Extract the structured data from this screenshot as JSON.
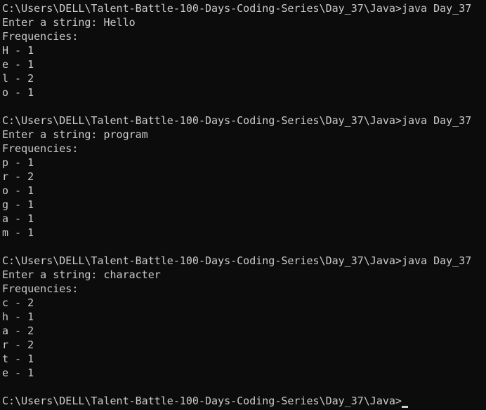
{
  "terminal": {
    "background_color": "#0c0c0c",
    "text_color": "#cccccc",
    "lines": [
      "C:\\Users\\DELL\\Talent-Battle-100-Days-Coding-Series\\Day_37\\Java>java Day_37",
      "Enter a string: Hello",
      "Frequencies:",
      "H - 1",
      "e - 1",
      "l - 2",
      "o - 1",
      "",
      "C:\\Users\\DELL\\Talent-Battle-100-Days-Coding-Series\\Day_37\\Java>java Day_37",
      "Enter a string: program",
      "Frequencies:",
      "p - 1",
      "r - 2",
      "o - 1",
      "g - 1",
      "a - 1",
      "m - 1",
      "",
      "C:\\Users\\DELL\\Talent-Battle-100-Days-Coding-Series\\Day_37\\Java>java Day_37",
      "Enter a string: character",
      "Frequencies:",
      "c - 2",
      "h - 1",
      "a - 2",
      "r - 2",
      "t - 1",
      "e - 1",
      "",
      "C:\\Users\\DELL\\Talent-Battle-100-Days-Coding-Series\\Day_37\\Java>"
    ]
  }
}
